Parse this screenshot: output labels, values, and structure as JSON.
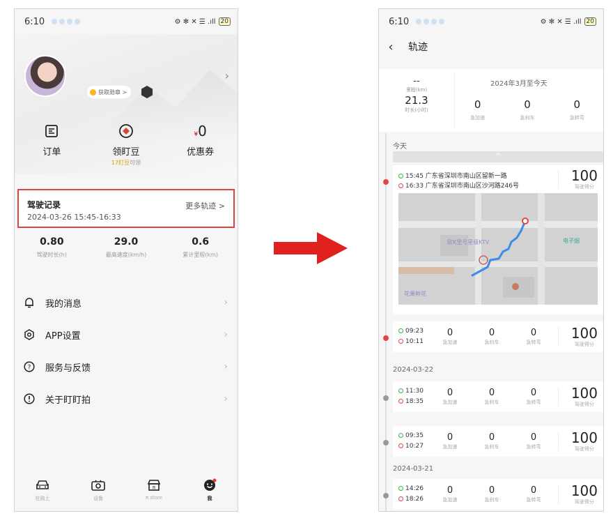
{
  "left": {
    "status": {
      "time": "6:10",
      "right_icons": "⚙ ✻ ✕ ☰ .ıll",
      "battery": "20"
    },
    "profile": {
      "badge_label": "获取勋章 >",
      "medal_level": "1"
    },
    "quick": [
      {
        "label": "订单",
        "sub": ""
      },
      {
        "label": "领盯豆",
        "sub_highlight": "17盯豆",
        "sub": "可领"
      },
      {
        "label": "优惠券",
        "value": "0",
        "currency": "¥"
      }
    ],
    "drive": {
      "title": "驾驶记录",
      "time": "2024-03-26 15:45-16:33",
      "more": "更多轨迹 >"
    },
    "stats": [
      {
        "value": "0.80",
        "label": "驾驶时长(h)"
      },
      {
        "value": "29.0",
        "label": "最高速度(km/h)"
      },
      {
        "value": "0.6",
        "label": "累计里程(km)"
      }
    ],
    "menu": [
      "我的消息",
      "APP设置",
      "服务与反馈",
      "关于盯盯拍"
    ],
    "tabs": [
      "在路上",
      "设备",
      "π store",
      "我"
    ]
  },
  "right": {
    "status": {
      "time": "6:10",
      "right_icons": "⚙ ✻ ✕ ☰ .ıll",
      "battery": "20"
    },
    "header": {
      "title": "轨迹"
    },
    "summary": {
      "dash": "--",
      "mileage_label": "里程(km)",
      "duration_value": "21.3",
      "duration_label": "时长(小时)",
      "period": "2024年3月至今天",
      "cols": [
        {
          "value": "0",
          "label": "急加速"
        },
        {
          "value": "0",
          "label": "急刹车"
        },
        {
          "value": "0",
          "label": "急转弯"
        }
      ]
    },
    "days": [
      {
        "label": "今天"
      },
      {
        "label": "2024-03-22"
      },
      {
        "label": "2024-03-21"
      }
    ],
    "collapse_icon": "^",
    "trip_main": {
      "start": "15:45 广东省深圳市南山区留新一路",
      "end": "16:33 广东省深圳市南山区沙河路246号",
      "score": "100",
      "score_label": "驾驶得分",
      "map_labels": [
        "欧K里号星级KTV",
        "电子烟",
        "花果鲜花"
      ]
    },
    "trips": [
      {
        "start": "09:23",
        "end": "10:11",
        "a": "0",
        "b": "0",
        "c": "0",
        "score": "100"
      },
      {
        "start": "11:30",
        "end": "18:35",
        "a": "0",
        "b": "0",
        "c": "0",
        "score": "100"
      },
      {
        "start": "09:35",
        "end": "10:27",
        "a": "0",
        "b": "0",
        "c": "0",
        "score": "100"
      },
      {
        "start": "14:26",
        "end": "18:26",
        "a": "0",
        "b": "0",
        "c": "0",
        "score": "100"
      }
    ],
    "col_labels": {
      "a": "急加速",
      "b": "急刹车",
      "c": "急转弯",
      "score": "驾驶得分"
    }
  },
  "colors": {
    "highlight_border": "#d94545",
    "arrow": "#e0211d",
    "route": "#3a8ee6"
  }
}
